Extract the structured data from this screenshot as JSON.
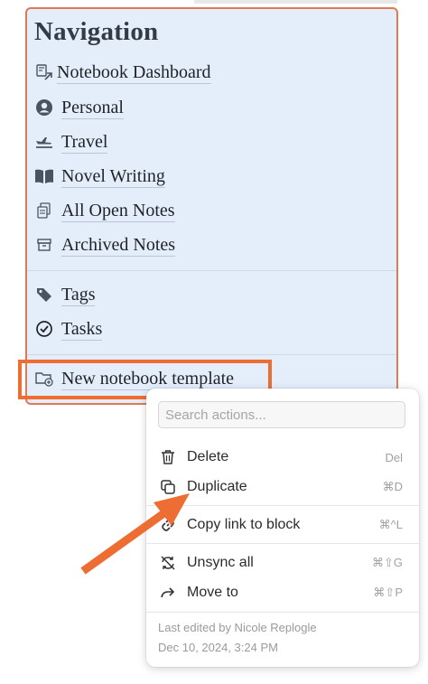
{
  "navigation": {
    "title": "Navigation",
    "items": [
      {
        "label": "Notebook Dashboard",
        "icon": "notebook-link-icon"
      },
      {
        "label": "Personal",
        "icon": "person-circle-icon"
      },
      {
        "label": "Travel",
        "icon": "airplane-icon"
      },
      {
        "label": "Novel Writing",
        "icon": "open-book-icon"
      },
      {
        "label": "All Open Notes",
        "icon": "notes-stack-icon"
      },
      {
        "label": "Archived Notes",
        "icon": "archive-box-icon"
      },
      {
        "label": "Tags",
        "icon": "tag-icon"
      },
      {
        "label": "Tasks",
        "icon": "check-circle-icon"
      },
      {
        "label": "New notebook template",
        "icon": "folder-plus-icon"
      }
    ]
  },
  "context_menu": {
    "search_placeholder": "Search actions...",
    "items": [
      {
        "label": "Delete",
        "shortcut": "Del",
        "icon": "trash-icon"
      },
      {
        "label": "Duplicate",
        "shortcut": "⌘D",
        "icon": "duplicate-icon"
      },
      {
        "label": "Copy link to block",
        "shortcut": "⌘^L",
        "icon": "link-icon"
      },
      {
        "label": "Unsync all",
        "shortcut": "⌘⇧G",
        "icon": "unsync-icon"
      },
      {
        "label": "Move to",
        "shortcut": "⌘⇧P",
        "icon": "arrow-right-icon"
      }
    ],
    "last_edited_by": "Last edited by Nicole Replogle",
    "last_edited_date": "Dec 10, 2024, 3:24 PM"
  },
  "colors": {
    "panel_bg": "#e4eefb",
    "panel_border": "#e07a55",
    "highlight": "#ee6d33",
    "arrow": "#ee6d33"
  }
}
